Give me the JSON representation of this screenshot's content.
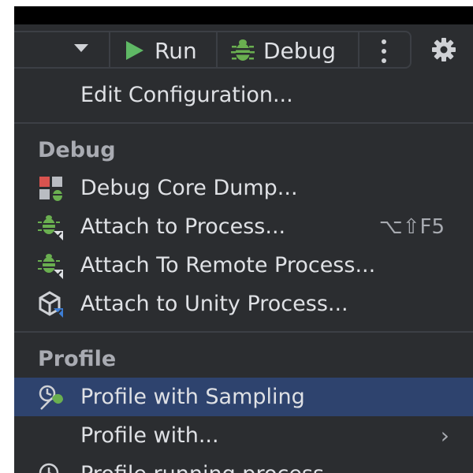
{
  "toolbar": {
    "run_label": "Run",
    "debug_label": "Debug"
  },
  "menu": {
    "edit_config": "Edit Configuration...",
    "debug_header": "Debug",
    "debug_items": [
      {
        "label": "Debug Core Dump...",
        "icon": "core-dump-icon"
      },
      {
        "label": "Attach to Process...",
        "shortcut": "⌥⇧F5",
        "icon": "attach-bug-icon"
      },
      {
        "label": "Attach To Remote Process...",
        "icon": "attach-remote-icon"
      },
      {
        "label": "Attach to Unity Process...",
        "icon": "unity-icon"
      }
    ],
    "profile_header": "Profile",
    "profile_items": [
      {
        "label": "Profile with Sampling",
        "icon": "profile-sampling-icon",
        "selected": true
      },
      {
        "label": "Profile with...",
        "submenu": true
      },
      {
        "label": "Profile running process...",
        "icon": "profile-running-icon"
      }
    ]
  },
  "colors": {
    "background": "#2b2d30",
    "selection": "#2e436e",
    "text": "#dfe1e5",
    "header_text": "#a9abb2",
    "run_green": "#5fb865",
    "debug_green": "#6aaf50",
    "accent_red": "#d9534f",
    "accent_blue": "#3d7ed6"
  }
}
